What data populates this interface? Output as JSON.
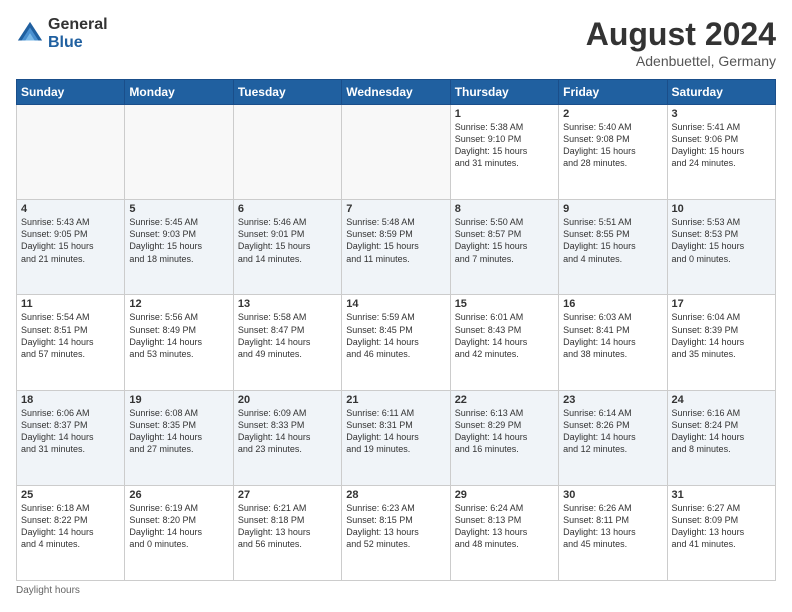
{
  "logo": {
    "general": "General",
    "blue": "Blue"
  },
  "header": {
    "month_year": "August 2024",
    "location": "Adenbuettel, Germany"
  },
  "days_of_week": [
    "Sunday",
    "Monday",
    "Tuesday",
    "Wednesday",
    "Thursday",
    "Friday",
    "Saturday"
  ],
  "weeks": [
    [
      {
        "day": "",
        "info": ""
      },
      {
        "day": "",
        "info": ""
      },
      {
        "day": "",
        "info": ""
      },
      {
        "day": "",
        "info": ""
      },
      {
        "day": "1",
        "info": "Sunrise: 5:38 AM\nSunset: 9:10 PM\nDaylight: 15 hours\nand 31 minutes."
      },
      {
        "day": "2",
        "info": "Sunrise: 5:40 AM\nSunset: 9:08 PM\nDaylight: 15 hours\nand 28 minutes."
      },
      {
        "day": "3",
        "info": "Sunrise: 5:41 AM\nSunset: 9:06 PM\nDaylight: 15 hours\nand 24 minutes."
      }
    ],
    [
      {
        "day": "4",
        "info": "Sunrise: 5:43 AM\nSunset: 9:05 PM\nDaylight: 15 hours\nand 21 minutes."
      },
      {
        "day": "5",
        "info": "Sunrise: 5:45 AM\nSunset: 9:03 PM\nDaylight: 15 hours\nand 18 minutes."
      },
      {
        "day": "6",
        "info": "Sunrise: 5:46 AM\nSunset: 9:01 PM\nDaylight: 15 hours\nand 14 minutes."
      },
      {
        "day": "7",
        "info": "Sunrise: 5:48 AM\nSunset: 8:59 PM\nDaylight: 15 hours\nand 11 minutes."
      },
      {
        "day": "8",
        "info": "Sunrise: 5:50 AM\nSunset: 8:57 PM\nDaylight: 15 hours\nand 7 minutes."
      },
      {
        "day": "9",
        "info": "Sunrise: 5:51 AM\nSunset: 8:55 PM\nDaylight: 15 hours\nand 4 minutes."
      },
      {
        "day": "10",
        "info": "Sunrise: 5:53 AM\nSunset: 8:53 PM\nDaylight: 15 hours\nand 0 minutes."
      }
    ],
    [
      {
        "day": "11",
        "info": "Sunrise: 5:54 AM\nSunset: 8:51 PM\nDaylight: 14 hours\nand 57 minutes."
      },
      {
        "day": "12",
        "info": "Sunrise: 5:56 AM\nSunset: 8:49 PM\nDaylight: 14 hours\nand 53 minutes."
      },
      {
        "day": "13",
        "info": "Sunrise: 5:58 AM\nSunset: 8:47 PM\nDaylight: 14 hours\nand 49 minutes."
      },
      {
        "day": "14",
        "info": "Sunrise: 5:59 AM\nSunset: 8:45 PM\nDaylight: 14 hours\nand 46 minutes."
      },
      {
        "day": "15",
        "info": "Sunrise: 6:01 AM\nSunset: 8:43 PM\nDaylight: 14 hours\nand 42 minutes."
      },
      {
        "day": "16",
        "info": "Sunrise: 6:03 AM\nSunset: 8:41 PM\nDaylight: 14 hours\nand 38 minutes."
      },
      {
        "day": "17",
        "info": "Sunrise: 6:04 AM\nSunset: 8:39 PM\nDaylight: 14 hours\nand 35 minutes."
      }
    ],
    [
      {
        "day": "18",
        "info": "Sunrise: 6:06 AM\nSunset: 8:37 PM\nDaylight: 14 hours\nand 31 minutes."
      },
      {
        "day": "19",
        "info": "Sunrise: 6:08 AM\nSunset: 8:35 PM\nDaylight: 14 hours\nand 27 minutes."
      },
      {
        "day": "20",
        "info": "Sunrise: 6:09 AM\nSunset: 8:33 PM\nDaylight: 14 hours\nand 23 minutes."
      },
      {
        "day": "21",
        "info": "Sunrise: 6:11 AM\nSunset: 8:31 PM\nDaylight: 14 hours\nand 19 minutes."
      },
      {
        "day": "22",
        "info": "Sunrise: 6:13 AM\nSunset: 8:29 PM\nDaylight: 14 hours\nand 16 minutes."
      },
      {
        "day": "23",
        "info": "Sunrise: 6:14 AM\nSunset: 8:26 PM\nDaylight: 14 hours\nand 12 minutes."
      },
      {
        "day": "24",
        "info": "Sunrise: 6:16 AM\nSunset: 8:24 PM\nDaylight: 14 hours\nand 8 minutes."
      }
    ],
    [
      {
        "day": "25",
        "info": "Sunrise: 6:18 AM\nSunset: 8:22 PM\nDaylight: 14 hours\nand 4 minutes."
      },
      {
        "day": "26",
        "info": "Sunrise: 6:19 AM\nSunset: 8:20 PM\nDaylight: 14 hours\nand 0 minutes."
      },
      {
        "day": "27",
        "info": "Sunrise: 6:21 AM\nSunset: 8:18 PM\nDaylight: 13 hours\nand 56 minutes."
      },
      {
        "day": "28",
        "info": "Sunrise: 6:23 AM\nSunset: 8:15 PM\nDaylight: 13 hours\nand 52 minutes."
      },
      {
        "day": "29",
        "info": "Sunrise: 6:24 AM\nSunset: 8:13 PM\nDaylight: 13 hours\nand 48 minutes."
      },
      {
        "day": "30",
        "info": "Sunrise: 6:26 AM\nSunset: 8:11 PM\nDaylight: 13 hours\nand 45 minutes."
      },
      {
        "day": "31",
        "info": "Sunrise: 6:27 AM\nSunset: 8:09 PM\nDaylight: 13 hours\nand 41 minutes."
      }
    ]
  ],
  "footer": {
    "daylight_label": "Daylight hours"
  }
}
